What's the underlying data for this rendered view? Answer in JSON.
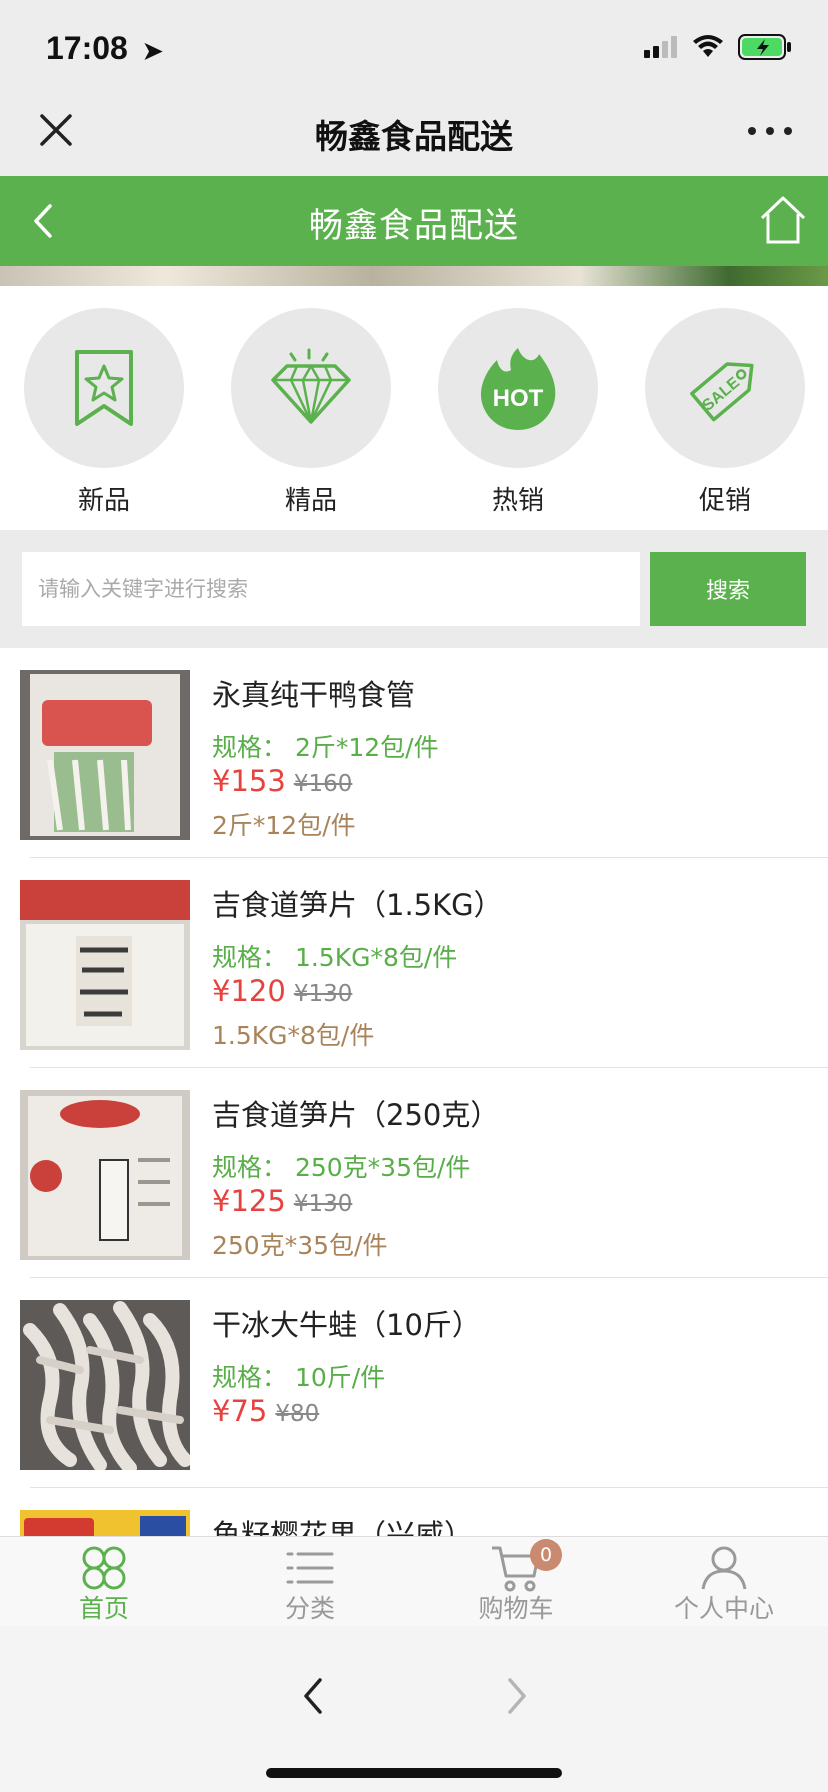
{
  "status_bar": {
    "time": "17:08"
  },
  "wechat_nav": {
    "title": "畅鑫食品配送"
  },
  "header": {
    "title": "畅鑫食品配送"
  },
  "categories": [
    {
      "label": "新品",
      "icon": "bookmark-star-icon"
    },
    {
      "label": "精品",
      "icon": "diamond-icon"
    },
    {
      "label": "热销",
      "icon": "hot-flame-icon",
      "badge_text": "HOT"
    },
    {
      "label": "促销",
      "icon": "sale-tag-icon",
      "badge_text": "SALE"
    }
  ],
  "search": {
    "placeholder": "请输入关键字进行搜索",
    "button_label": "搜索"
  },
  "products": [
    {
      "name": "永真纯干鸭食管",
      "spec": "规格：   2斤*12包/件",
      "price": "¥153",
      "old_price": "¥160",
      "note": "2斤*12包/件"
    },
    {
      "name": "吉食道笋片（1.5KG）",
      "spec": "规格：   1.5KG*8包/件",
      "price": "¥120",
      "old_price": "¥130",
      "note": "1.5KG*8包/件"
    },
    {
      "name": "吉食道笋片（250克）",
      "spec": "规格：   250克*35包/件",
      "price": "¥125",
      "old_price": "¥130",
      "note": "250克*35包/件"
    },
    {
      "name": "干冰大牛蛙（10斤）",
      "spec": "规格：   10斤/件",
      "price": "¥75",
      "old_price": "¥80",
      "note": ""
    },
    {
      "name": "鱼籽樱花果（兴威）",
      "spec": "",
      "price": "",
      "old_price": "",
      "note": ""
    }
  ],
  "tabbar": [
    {
      "label": "首页",
      "icon": "clover-home-icon",
      "active": true
    },
    {
      "label": "分类",
      "icon": "list-icon",
      "active": false
    },
    {
      "label": "购物车",
      "icon": "cart-icon",
      "active": false,
      "badge": "0"
    },
    {
      "label": "个人中心",
      "icon": "user-icon",
      "active": false
    }
  ],
  "colors": {
    "brand_green": "#5bb14d",
    "price_red": "#e64340",
    "note_brown": "#a9845b"
  }
}
